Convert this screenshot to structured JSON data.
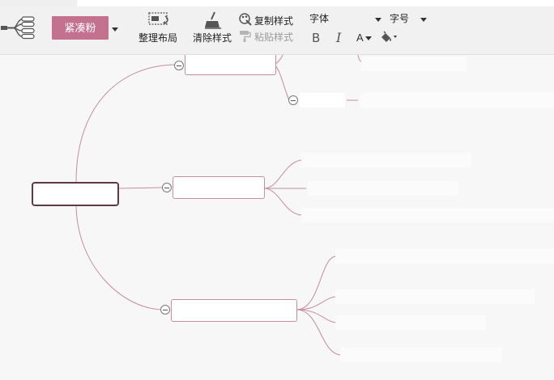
{
  "toolbar": {
    "theme_label": "紧凑粉",
    "tidy_layout_label": "整理布局",
    "clear_style_label": "清除样式",
    "copy_style_label": "复制样式",
    "paste_style_label": "粘贴样式",
    "font_label": "字体",
    "font_size_label": "字号",
    "bold_label": "B",
    "italic_label": "I",
    "font_color_label": "A",
    "accent_color": "#c4718f"
  },
  "mindmap": {
    "line_color": "#c48ea0",
    "root_border_color": "#5e3a48"
  }
}
